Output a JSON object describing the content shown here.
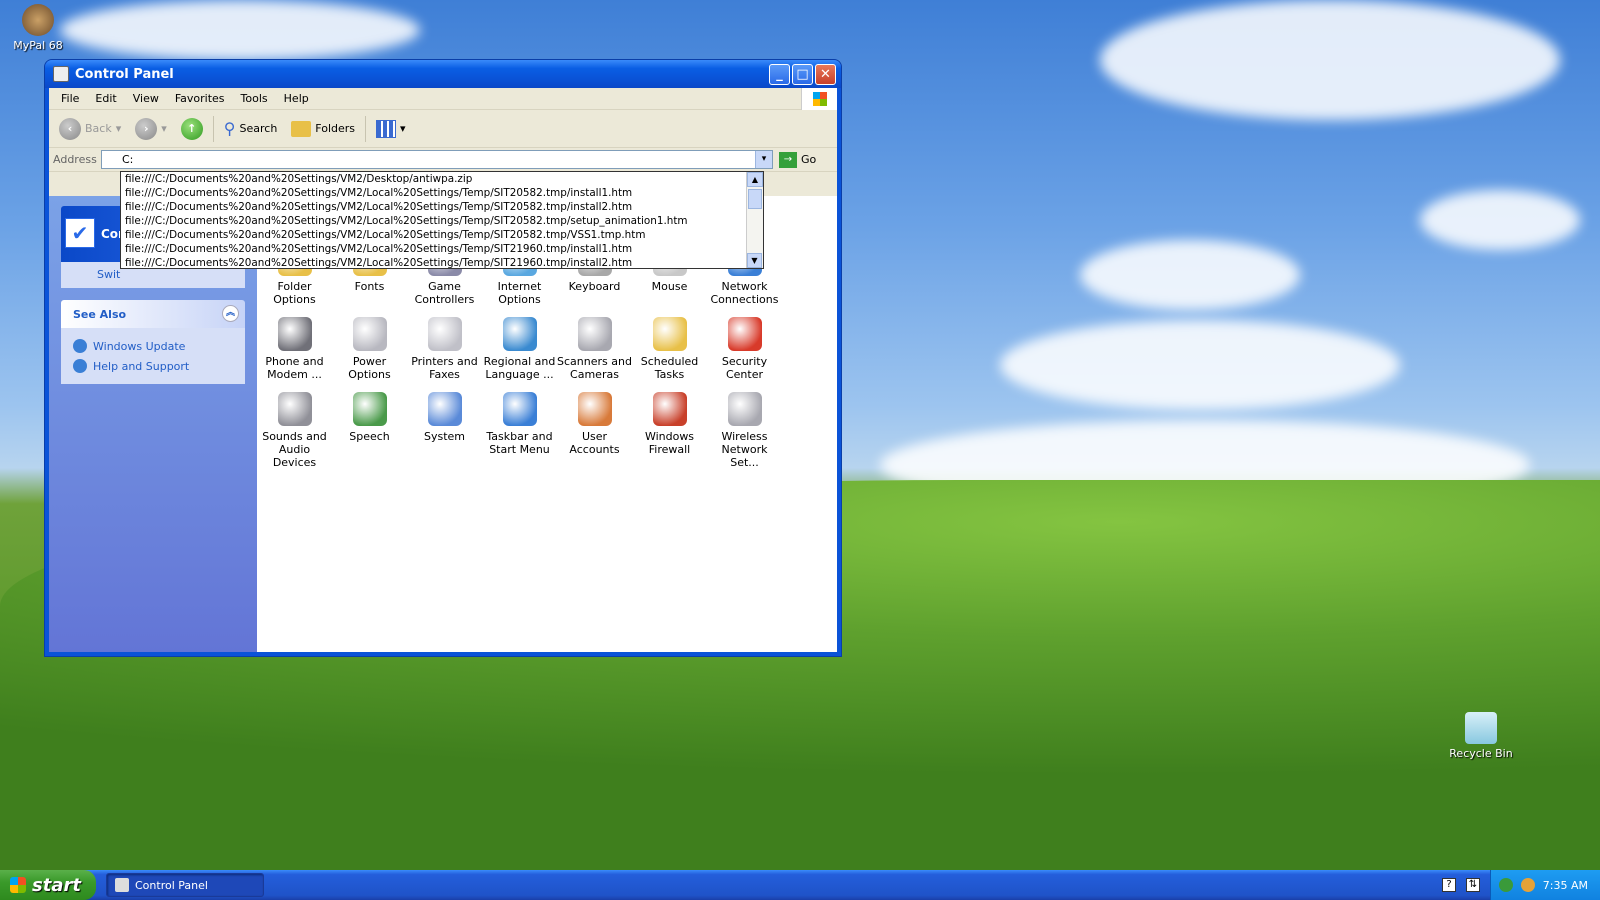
{
  "desktop": {
    "icons": [
      {
        "label": "MyPal 68"
      },
      {
        "label": "Recycle Bin"
      }
    ]
  },
  "window": {
    "title": "Control Panel",
    "controls": {
      "minimize": "_",
      "maximize": "□",
      "close": "✕"
    },
    "menu": [
      "File",
      "Edit",
      "View",
      "Favorites",
      "Tools",
      "Help"
    ],
    "toolbar": {
      "back": "Back",
      "search": "Search",
      "folders": "Folders"
    },
    "address": {
      "label": "Address",
      "value": "C:",
      "go": "Go",
      "suggestions": [
        "file:///C:/Documents%20and%20Settings/VM2/Desktop/antiwpa.zip",
        "file:///C:/Documents%20and%20Settings/VM2/Local%20Settings/Temp/SIT20582.tmp/install1.htm",
        "file:///C:/Documents%20and%20Settings/VM2/Local%20Settings/Temp/SIT20582.tmp/install2.htm",
        "file:///C:/Documents%20and%20Settings/VM2/Local%20Settings/Temp/SIT20582.tmp/setup_animation1.htm",
        "file:///C:/Documents%20and%20Settings/VM2/Local%20Settings/Temp/SIT20582.tmp/VSS1.tmp.htm",
        "file:///C:/Documents%20and%20Settings/VM2/Local%20Settings/Temp/SIT21960.tmp/install1.htm",
        "file:///C:/Documents%20and%20Settings/VM2/Local%20Settings/Temp/SIT21960.tmp/install2.htm"
      ]
    },
    "left": {
      "cp_title": "Cont",
      "switch": "Swit",
      "see_also": {
        "title": "See Also",
        "links": [
          "Windows Update",
          "Help and Support"
        ]
      }
    },
    "items": [
      {
        "label": "Folder Options",
        "color": "#e8c048"
      },
      {
        "label": "Fonts",
        "color": "#e8c048"
      },
      {
        "label": "Game Controllers",
        "color": "#8a8aa8"
      },
      {
        "label": "Internet Options",
        "color": "#5aa8e0"
      },
      {
        "label": "Keyboard",
        "color": "#a8a8a8"
      },
      {
        "label": "Mouse",
        "color": "#c8c8c8"
      },
      {
        "label": "Network Connections",
        "color": "#3a7fd6"
      },
      {
        "label": "Phone and Modem ...",
        "color": "#707078"
      },
      {
        "label": "Power Options",
        "color": "#b8b8c0"
      },
      {
        "label": "Printers and Faxes",
        "color": "#c0c0c8"
      },
      {
        "label": "Regional and Language ...",
        "color": "#3a8ad0"
      },
      {
        "label": "Scanners and Cameras",
        "color": "#a8a8b0"
      },
      {
        "label": "Scheduled Tasks",
        "color": "#e8c048"
      },
      {
        "label": "Security Center",
        "color": "#d83a2a"
      },
      {
        "label": "Sounds and Audio Devices",
        "color": "#909098"
      },
      {
        "label": "Speech",
        "color": "#4a9a4a"
      },
      {
        "label": "System",
        "color": "#5a8ad8"
      },
      {
        "label": "Taskbar and Start Menu",
        "color": "#3a7fd6"
      },
      {
        "label": "User Accounts",
        "color": "#d87a3a"
      },
      {
        "label": "Windows Firewall",
        "color": "#c8402a"
      },
      {
        "label": "Wireless Network Set...",
        "color": "#a8a8b0"
      }
    ]
  },
  "taskbar": {
    "start": "start",
    "task": "Control Panel",
    "clock": "7:35 AM"
  }
}
